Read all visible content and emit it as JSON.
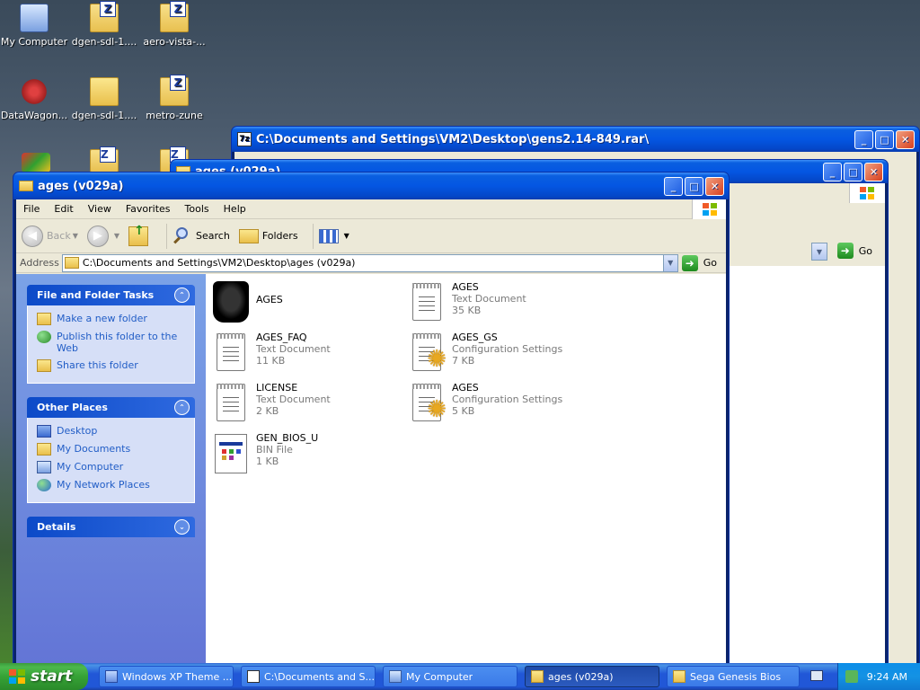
{
  "desktop": {
    "icons": [
      {
        "label": "My Computer",
        "icon": "my-computer-icon"
      },
      {
        "label": "dgen-sdl-1....",
        "icon": "zip-folder-icon"
      },
      {
        "label": "aero-vista-...",
        "icon": "zip-folder-icon"
      },
      {
        "label": "DataWagon...",
        "icon": "datawagon-icon"
      },
      {
        "label": "dgen-sdl-1....",
        "icon": "folder-icon"
      },
      {
        "label": "metro-zune",
        "icon": "zip-folder-icon"
      }
    ]
  },
  "bg_window_rar": {
    "title": "C:\\Documents and Settings\\VM2\\Desktop\\gens2.14-849.rar\\"
  },
  "bg_window_mid": {
    "title": "ages (v029a)",
    "go_label": "Go"
  },
  "explorer": {
    "title": "ages (v029a)",
    "menu": [
      "File",
      "Edit",
      "View",
      "Favorites",
      "Tools",
      "Help"
    ],
    "toolbar": {
      "back": "Back",
      "search": "Search",
      "folders": "Folders"
    },
    "address": {
      "label": "Address",
      "value": "C:\\Documents and Settings\\VM2\\Desktop\\ages (v029a)",
      "go": "Go"
    },
    "tasks_panel": {
      "title": "File and Folder Tasks",
      "items": [
        "Make a new folder",
        "Publish this folder to the Web",
        "Share this folder"
      ]
    },
    "places_panel": {
      "title": "Other Places",
      "items": [
        "Desktop",
        "My Documents",
        "My Computer",
        "My Network Places"
      ]
    },
    "details_panel": {
      "title": "Details"
    },
    "files": [
      {
        "name": "AGES",
        "type": "",
        "size": "",
        "icon": "ages-app-icon"
      },
      {
        "name": "AGES",
        "type": "Text Document",
        "size": "35 KB",
        "icon": "text-document-icon"
      },
      {
        "name": "AGES_FAQ",
        "type": "Text Document",
        "size": "11 KB",
        "icon": "text-document-icon"
      },
      {
        "name": "AGES_GS",
        "type": "Configuration Settings",
        "size": "7 KB",
        "icon": "config-settings-icon"
      },
      {
        "name": "LICENSE",
        "type": "Text Document",
        "size": "2 KB",
        "icon": "text-document-icon"
      },
      {
        "name": "AGES",
        "type": "Configuration Settings",
        "size": "5 KB",
        "icon": "config-settings-icon"
      },
      {
        "name": "GEN_BIOS_U",
        "type": "BIN File",
        "size": "1 KB",
        "icon": "bin-file-icon"
      }
    ]
  },
  "taskbar": {
    "start": "start",
    "buttons": [
      {
        "label": "Windows XP Theme ...",
        "active": false
      },
      {
        "label": "C:\\Documents and S...",
        "active": false
      },
      {
        "label": "My Computer",
        "active": false
      },
      {
        "label": "ages (v029a)",
        "active": true
      },
      {
        "label": "Sega Genesis Bios",
        "active": false
      }
    ],
    "clock": "9:24 AM"
  }
}
